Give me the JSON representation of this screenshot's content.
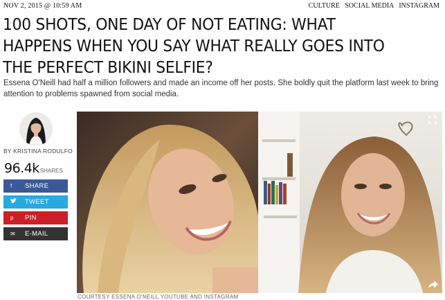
{
  "header": {
    "date": "NOV 2, 2015 @ 10:59 AM",
    "tags": [
      "CULTURE",
      "SOCIAL MEDIA",
      "INSTAGRAM"
    ]
  },
  "article": {
    "headline_lines": [
      "100 SHOTS, ONE DAY OF NOT EATING: WHAT",
      "HAPPENS WHEN YOU SAY WHAT REALLY GOES INTO",
      "THE PERFECT BIKINI SELFIE?"
    ],
    "deck": "Essena O'Neill had half a million followers and made an income off her posts. She boldly quit the platform last week to bring attention to problems spawned from social media.",
    "byline": "BY KRISTINA RODULFO",
    "caption": "COURTESY ESSENA O'NEILL YOUTUBE AND INSTAGRAM"
  },
  "shares": {
    "count": "96.4k",
    "label": "SHARES",
    "buttons": [
      {
        "icon": "f",
        "label": "SHARE",
        "color": "#3b5998"
      },
      {
        "icon": "t",
        "label": "TWEET",
        "color": "#28a9e0"
      },
      {
        "icon": "p",
        "label": "PIN",
        "color": "#cb2027"
      },
      {
        "icon": "✉",
        "label": "E-MAIL",
        "color": "#333333"
      }
    ]
  }
}
